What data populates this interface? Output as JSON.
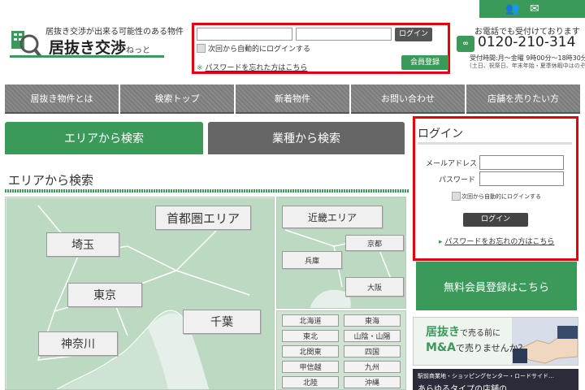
{
  "header": {
    "tagline": "居抜き交渉が出来る可能性のある物件",
    "site_name": "居抜き交渉",
    "site_name_suffix": "ねっと",
    "top_icons": [
      "people-icon",
      "mail-icon"
    ]
  },
  "top_login": {
    "login_button": "ログイン",
    "auto_login_label": "次回から自動的にログインする",
    "forgot_mark": "※",
    "forgot_link": "パスワードを忘れた方はこちら",
    "register_button": "会員登録"
  },
  "phone": {
    "note": "お電話でも受付けております",
    "number": "0120-210-314",
    "hours": "受付時間:月～金曜 9時00分～18時30分",
    "hours_note": "(土日、祝祭日、年末年始・夏季休暇中はのぞく)",
    "free_dial_label": "∞"
  },
  "nav": {
    "items": [
      "居抜き物件とは",
      "検索トップ",
      "新着物件",
      "お問い合わせ",
      "店舗を売りたい方"
    ]
  },
  "tabs": {
    "area": "エリアから検索",
    "gyoshu": "業種から検索"
  },
  "main": {
    "section_title": "エリアから検索"
  },
  "map_kanto": {
    "labels": {
      "shutoken": "首都圏エリア",
      "saitama": "埼玉",
      "tokyo": "東京",
      "chiba": "千葉",
      "kanagawa": "神奈川"
    }
  },
  "map_kinki": {
    "labels": {
      "kinki": "近畿エリア",
      "kyoto": "京都",
      "hyogo": "兵庫",
      "osaka": "大阪"
    }
  },
  "regions": {
    "items": [
      "北海道",
      "東海",
      "東北",
      "山陰・山陽",
      "北関東",
      "四国",
      "甲信越",
      "九州",
      "北陸",
      "沖縄"
    ]
  },
  "side_login": {
    "title": "ログイン",
    "email_label": "メールアドレス",
    "password_label": "パスワード",
    "auto_login_label": "次回から自動的にログインする",
    "login_button": "ログイン",
    "forgot_mark": "▸",
    "forgot_link": "パスワードをお忘れの方はこちら"
  },
  "banners": {
    "register": "無料会員登録はこちら",
    "ma_word": "居抜き",
    "ma_rest1": "で売る前に",
    "ma_word2": "M&A",
    "ma_rest2": "で売りませんか？",
    "shop_line1": "駅前商業地・ショッピングセンター・ロードサイド…",
    "shop_line2": "あらゆるタイプの店舗の"
  },
  "colors": {
    "brand_green": "#3b9a5a",
    "highlight_red": "#e60012",
    "nav_gray": "#858585"
  }
}
